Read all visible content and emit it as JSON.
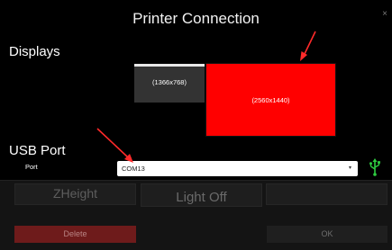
{
  "background": {
    "zheight_label": "ZHeight",
    "light_label": "Light Off",
    "delete_label": "Delete",
    "ok_label": "OK"
  },
  "dialog": {
    "title": "Printer Connection",
    "close_glyph": "×",
    "displays_label": "Displays",
    "monitors": [
      {
        "label": "(1366x768)",
        "selected": false
      },
      {
        "label": "(2560x1440)",
        "selected": true
      }
    ],
    "usb_label": "USB Port",
    "port_label": "Port",
    "port_value": "COM13",
    "select_caret": "▾"
  },
  "colors": {
    "selected_monitor": "#ff0000",
    "annotation_arrow": "#ff2a2a",
    "usb_icon": "#2ecc40"
  },
  "icons": {
    "close": "close-icon",
    "usb": "usb-icon",
    "caret": "chevron-down-icon"
  }
}
